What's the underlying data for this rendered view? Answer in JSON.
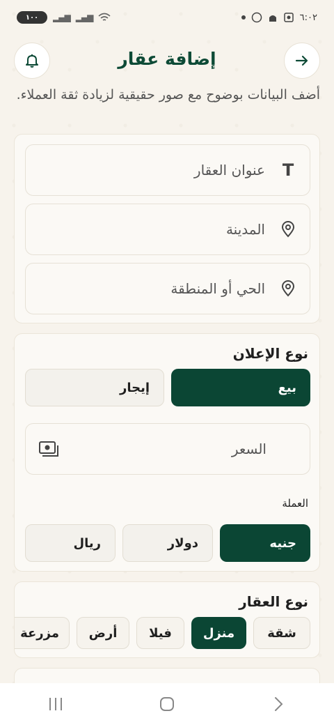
{
  "status_bar": {
    "time": "٦:٠٢",
    "battery": "١٠٠"
  },
  "header": {
    "title": "إضافة عقار",
    "back_icon": "arrow-right-icon",
    "notify_icon": "bell-icon"
  },
  "subtitle": "أضف البيانات بوضوح مع صور حقيقية لزيادة ثقة العملاء.",
  "location_card": {
    "title_placeholder": "عنوان العقار",
    "city_placeholder": "المدينة",
    "district_placeholder": "الحي أو المنطقة"
  },
  "listing_card": {
    "section_title": "نوع الإعلان",
    "options": [
      "بيع",
      "إيجار"
    ],
    "selected": "بيع",
    "price_placeholder": "السعر",
    "currency_label": "العملة",
    "currencies": [
      "جنيه",
      "دولار",
      "ريال"
    ],
    "selected_currency": "جنيه"
  },
  "property_card": {
    "section_title": "نوع العقار",
    "types": [
      "شقة",
      "منزل",
      "فيلا",
      "أرض",
      "مزرعة"
    ],
    "selected": "منزل"
  },
  "colors": {
    "primary": "#0b4634",
    "background": "#f7f3ec",
    "card": "#fbf9f5"
  }
}
